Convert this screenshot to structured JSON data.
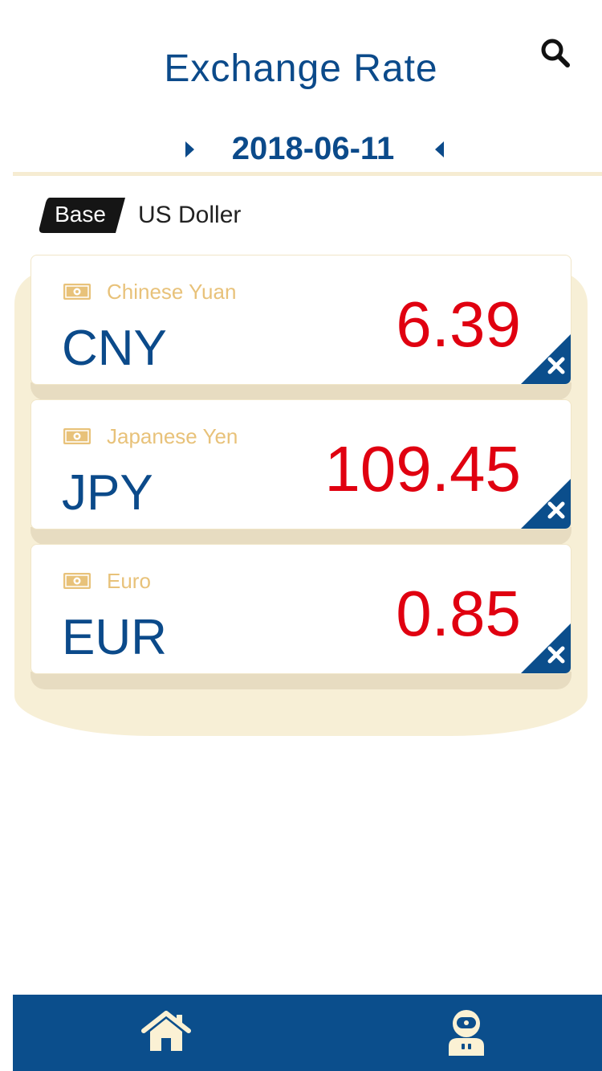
{
  "header": {
    "title": "Exchange Rate",
    "search_icon": "search-icon"
  },
  "date": {
    "value": "2018-06-11",
    "prev_icon": "caret-right-icon",
    "next_icon": "caret-left-icon"
  },
  "base": {
    "badge_label": "Base",
    "currency": "US Doller"
  },
  "rates": [
    {
      "name": "Chinese Yuan",
      "code": "CNY",
      "rate": "6.39"
    },
    {
      "name": "Japanese Yen",
      "code": "JPY",
      "rate": "109.45"
    },
    {
      "name": "Euro",
      "code": "EUR",
      "rate": "0.85"
    }
  ],
  "tabbar": {
    "home_icon": "home-icon",
    "profile_icon": "astronaut-icon"
  },
  "colors": {
    "primary": "#0b4a8a",
    "accent": "#e8c27a",
    "rate": "#e00010",
    "cream": "#f7efd6"
  }
}
